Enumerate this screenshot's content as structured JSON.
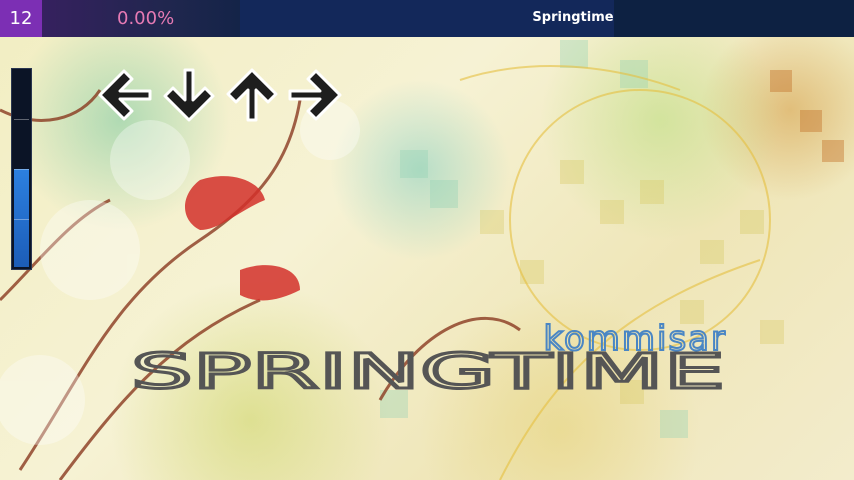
{
  "header": {
    "difficulty_level": "12",
    "score": "0.00%",
    "song_title": "Springtime"
  },
  "life_meter": {
    "fill_fraction": 0.5
  },
  "receptors": [
    {
      "direction": "left",
      "icon": "arrow-left-icon"
    },
    {
      "direction": "down",
      "icon": "arrow-down-icon"
    },
    {
      "direction": "up",
      "icon": "arrow-up-icon"
    },
    {
      "direction": "right",
      "icon": "arrow-right-icon"
    }
  ],
  "banner": {
    "artist": "kommisar",
    "title": "SPRINGTIME"
  },
  "colors": {
    "top_bar": "#0d2142",
    "level_box": "#7c2fb4",
    "score_text": "#e67ab4",
    "life_fill": "#2c80e0",
    "artist_text": "#4a86c4"
  }
}
